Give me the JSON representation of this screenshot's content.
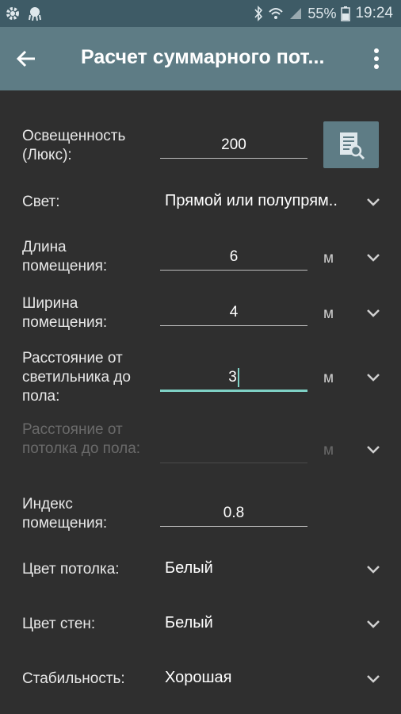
{
  "status": {
    "battery": "55%",
    "time": "19:24"
  },
  "appbar": {
    "title": "Расчет суммарного пот..."
  },
  "rows": {
    "illuminance": {
      "label": "Освещенность (Люкс):",
      "value": "200"
    },
    "light": {
      "label": "Свет:",
      "value": "Прямой или полупрям.."
    },
    "length": {
      "label": "Длина помещения:",
      "value": "6",
      "unit": "м"
    },
    "width": {
      "label": "Ширина помещения:",
      "value": "4",
      "unit": "м"
    },
    "lamp_floor": {
      "label": "Расстояние от светильника до пола:",
      "value": "3",
      "unit": "м"
    },
    "ceiling_floor": {
      "label": "Расстояние от потолка до пола:",
      "value": "",
      "unit": "м"
    },
    "room_index": {
      "label": "Индекс помещения:",
      "value": "0.8"
    },
    "ceiling_color": {
      "label": "Цвет потолка:",
      "value": "Белый"
    },
    "wall_color": {
      "label": "Цвет стен:",
      "value": "Белый"
    },
    "stability": {
      "label": "Стабильность:",
      "value": "Хорошая"
    }
  }
}
